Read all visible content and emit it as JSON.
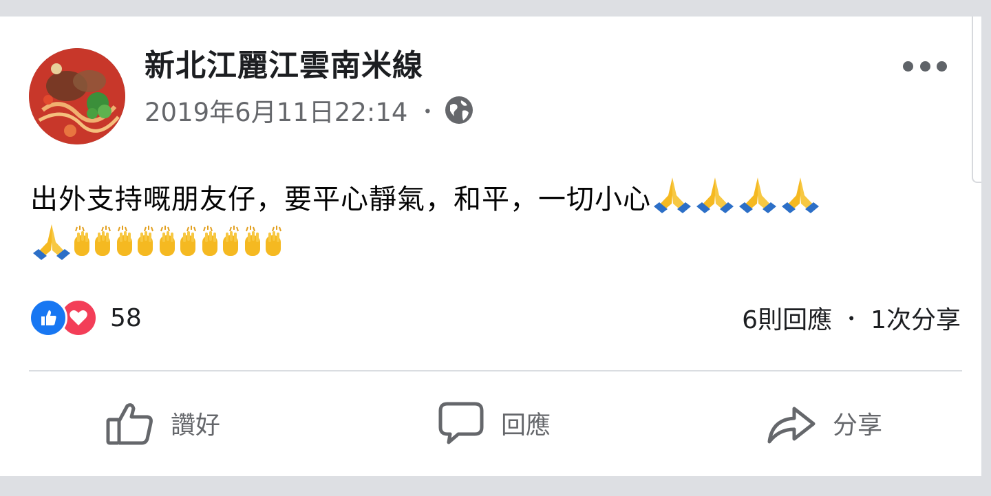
{
  "post": {
    "page_name": "新北江麗江雲南米線",
    "timestamp": "2019年6月11日22:14",
    "meta_separator": "・",
    "audience_icon": "globe-icon",
    "more_icon": "more-horizontal-icon",
    "text": "出外支持嘅朋友仔，要平心靜氣，和平，一切小心",
    "emoji_line1": [
      "folded-hands",
      "folded-hands",
      "folded-hands",
      "folded-hands"
    ],
    "emoji_line2_start": [
      "folded-hands"
    ],
    "emoji_line2_hands": [
      "raising-hands",
      "raising-hands",
      "raising-hands",
      "raising-hands",
      "raising-hands"
    ]
  },
  "reactions": {
    "icons": [
      "like-icon",
      "love-icon"
    ],
    "count": "58"
  },
  "stats": {
    "comments": "6則回應",
    "separator": "・",
    "shares": "1次分享"
  },
  "actions": {
    "like_label": "讚好",
    "comment_label": "回應",
    "share_label": "分享"
  },
  "colors": {
    "like_blue": "#1877f2",
    "love_red": "#f33e58",
    "text_primary": "#1c1e21",
    "text_secondary": "#65676b",
    "background": "#dddfe3"
  }
}
